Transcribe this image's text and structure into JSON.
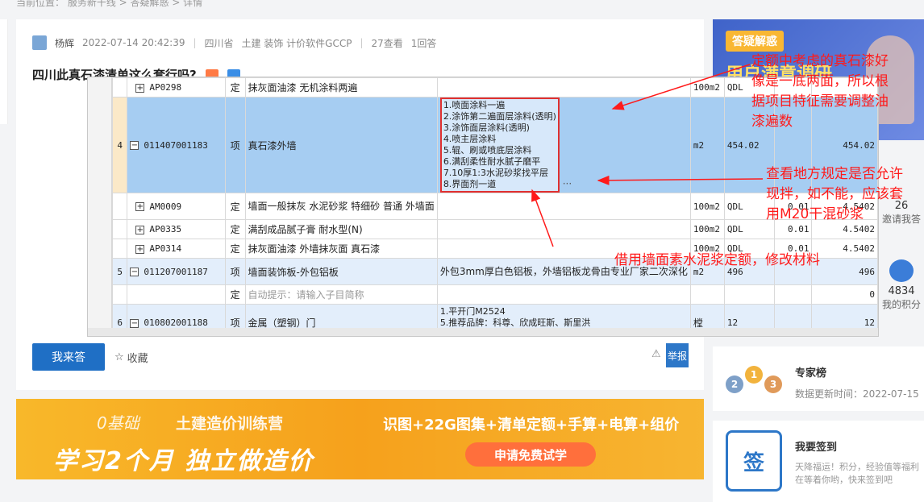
{
  "breadcrumb": "当前位置：  服务新干线  >  答疑解惑  >  详情",
  "post": {
    "author": "杨辉",
    "datetime": "2022-07-14 20:42:39",
    "region": "四川省",
    "category": "土建 装饰 计价软件GCCP",
    "views": "27查看",
    "answers": "1回答",
    "title": "四川此真石漆清单这么套行吗?"
  },
  "actions": {
    "answer": "我来答",
    "collect": "收藏",
    "report": "举报"
  },
  "banner": {
    "tag": "0基础",
    "tag2": "土建造价训练营",
    "main": "学习2个月  独立做造价",
    "sub": "识图+22G图集+清单定额+手算+电算+组价",
    "button": "申请免费试学"
  },
  "sidebar": {
    "promo_tag": "答疑解惑",
    "promo_big": "用户满意调研",
    "invite_count": "26",
    "invite_label": "邀请我答",
    "points_count": "4834",
    "points_label": "我的积分",
    "expert_title": "专家榜",
    "expert_sub": "数据更新时间：2022-07-15",
    "sign_title": "我要签到",
    "sign_icon": "签",
    "sign_sub": "天降福运！积分，经验值等福利在等着你哟，快来签到吧"
  },
  "table": {
    "rows": [
      {
        "idx": "",
        "code": "AP0298",
        "type": "定",
        "name": "抹灰面油漆 无机涂料两遍",
        "feature": "",
        "unit": "100m2",
        "expr": "QDL",
        "coef": "",
        "qty": ""
      },
      {
        "idx": "4",
        "code": "011407001183",
        "type": "项",
        "name": "真石漆外墙",
        "feature": "1.喷面涂料一遍\n2.涂饰第二遍面层涂料(透明)\n3.涂饰面层涂料(透明)\n4.喷主层涂料\n5.辊、刷或喷底层涂料\n6.满刮柔性耐水腻子磨平\n7.10厚1:3水泥砂浆找平层\n8.界面剂一道",
        "unit": "m2",
        "expr": "454.02",
        "coef": "",
        "qty": "454.02"
      },
      {
        "idx": "",
        "code": "AM0009",
        "type": "定",
        "name": "墙面一般抹灰 水泥砂浆 特细砂 普通 外墙面",
        "feature": "",
        "unit": "100m2",
        "expr": "QDL",
        "coef": "0.01",
        "qty": "4.5402"
      },
      {
        "idx": "",
        "code": "AP0335",
        "type": "定",
        "name": "满刮成品腻子膏 耐水型(N)",
        "feature": "",
        "unit": "100m2",
        "expr": "QDL",
        "coef": "0.01",
        "qty": "4.5402"
      },
      {
        "idx": "",
        "code": "AP0314",
        "type": "定",
        "name": "抹灰面油漆 外墙抹灰面 真石漆",
        "feature": "",
        "unit": "100m2",
        "expr": "QDL",
        "coef": "0.01",
        "qty": "4.5402"
      },
      {
        "idx": "5",
        "code": "011207001187",
        "type": "项",
        "name": "墙面装饰板-外包铝板",
        "feature": "外包3mm厚白色铝板，外墙铝板龙骨由专业厂家二次深化",
        "unit": "m2",
        "expr": "496",
        "coef": "",
        "qty": "496"
      },
      {
        "idx": "",
        "code": "",
        "type": "定",
        "name": "自动提示：请输入子目简称",
        "feature": "",
        "unit": "",
        "expr": "",
        "coef": "",
        "qty": "0"
      },
      {
        "idx": "6",
        "code": "010802001188",
        "type": "项",
        "name": "金属（塑钢）门",
        "feature": "1.平开门M2524\n5.推荐品牌：科尊、欣成旺斯、斯里洪",
        "unit": "樘",
        "expr": "12",
        "coef": "",
        "qty": "12"
      }
    ],
    "ellipsis": "···"
  },
  "annotations": {
    "note1_l1": "定额中考虑的真石漆好",
    "note1_l2": "像是一底两面，所以根",
    "note1_l3": "据项目特征需要调整油",
    "note1_l4": "漆遍数",
    "note2_l1": "查看地方规定是否允许",
    "note2_l2": "现拌，如不能，应该套",
    "note2_l3": "用M20干混砂浆",
    "note3": "借用墙面素水泥浆定额，修改材料"
  }
}
